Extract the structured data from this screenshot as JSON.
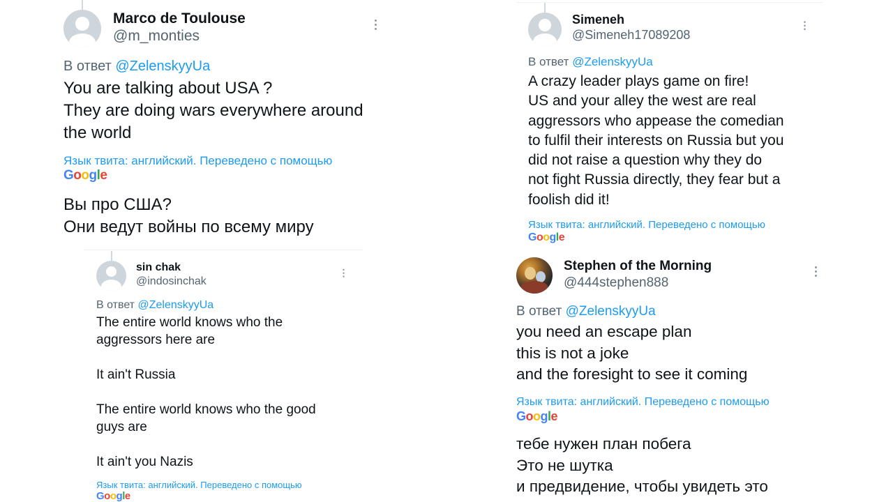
{
  "google_logo": {
    "letters": [
      "G",
      "o",
      "o",
      "g",
      "l",
      "e"
    ],
    "colors": [
      "#4285f4",
      "#ea4335",
      "#fbbc05",
      "#4285f4",
      "#34a853",
      "#ea4335"
    ]
  },
  "tweets": [
    {
      "name": "Marco de Toulouse",
      "handle": "@m_monties",
      "reply_prefix": "В ответ",
      "reply_mention": "@ZelenskyyUa",
      "lines": [
        "You are talking about USA ?",
        "They are doing wars everywhere around",
        "the world"
      ],
      "translate_note": "Язык твита: английский. Переведено с помощью",
      "google": "Google",
      "translation": [
        "Вы про США?",
        "Они ведут войны по всему миру"
      ]
    },
    {
      "name": "sin chak",
      "handle": "@indosinchak",
      "reply_prefix": "В ответ",
      "reply_mention": "@ZelenskyyUa",
      "lines": [
        "The entire world knows who the",
        "aggressors here are",
        "",
        "It ain't Russia",
        "",
        "The entire world knows who the good",
        "guys are",
        "",
        "It ain't you Nazis"
      ],
      "translate_note": "Язык твита: английский. Переведено с помощью",
      "google": "Google"
    },
    {
      "name": "Simeneh",
      "handle": "@Simeneh17089208",
      "reply_prefix": "В ответ",
      "reply_mention": "@ZelenskyyUa",
      "lines": [
        "A crazy leader plays game on fire!",
        "US and your alley the west  are real",
        "aggressors who appease the comedian",
        "to fulfil their interests on Russia but you",
        "did not raise a question why they do",
        "not fight Russia directly, they fear but a",
        "foolish did it!"
      ],
      "translate_note": "Язык твита: английский. Переведено с помощью",
      "google": "Google"
    },
    {
      "name": "Stephen of the Morning",
      "handle": "@444stephen888",
      "reply_prefix": "В ответ",
      "reply_mention": "@ZelenskyyUa",
      "lines": [
        "you need an escape plan",
        "this is not a joke",
        "and the foresight to see it coming"
      ],
      "translate_note": "Язык твита: английский. Переведено с помощью",
      "google": "Google",
      "translation": [
        "тебе нужен план побега",
        "Это не шутка",
        "и предвидение, чтобы увидеть это"
      ]
    }
  ]
}
